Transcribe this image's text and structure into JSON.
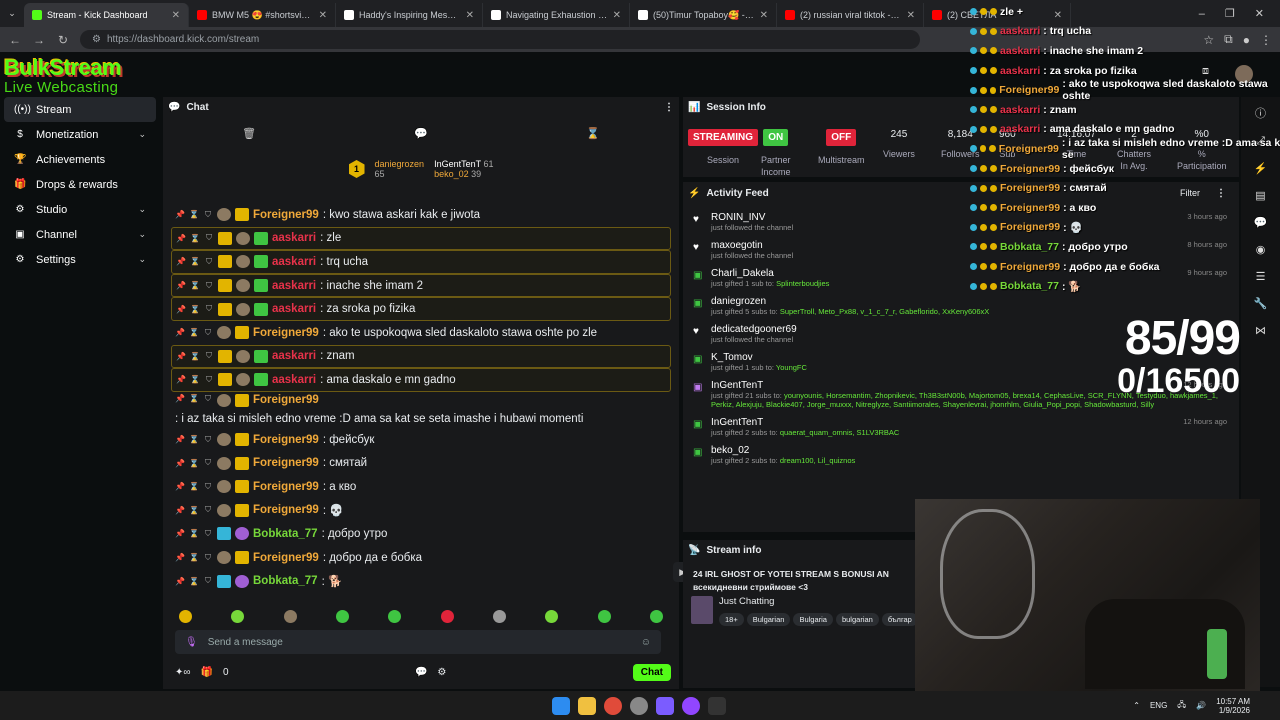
{
  "browser": {
    "tabs": [
      {
        "title": "Stream - Kick Dashboard",
        "color": "#53fc18",
        "active": true
      },
      {
        "title": "BMW M5 😍 #shortsvideo",
        "color": "#ff0000"
      },
      {
        "title": "Haddy's Inspiring Message Afte",
        "color": "#ffffff"
      },
      {
        "title": "Navigating Exhaustion in Mode",
        "color": "#ffffff"
      },
      {
        "title": "(50)Timur Topaboy🥰 - оригин",
        "color": "#ffffff"
      },
      {
        "title": "(2) russian viral tiktok - YouTub",
        "color": "#ff0000"
      },
      {
        "title": "(2) CBETЛA",
        "color": "#ff0000"
      }
    ],
    "url": "https://dashboard.kick.com/stream"
  },
  "logo": {
    "line1": "BulkStream",
    "line2": "Live Webcasting Services"
  },
  "sidebar": {
    "items": [
      {
        "label": "Stream",
        "icon": "broadcast-icon",
        "active": true
      },
      {
        "label": "Monetization",
        "icon": "dollar-icon",
        "chevron": true
      },
      {
        "label": "Achievements",
        "icon": "trophy-icon"
      },
      {
        "label": "Drops & rewards",
        "icon": "gift-icon"
      },
      {
        "label": "Studio",
        "icon": "studio-icon",
        "chevron": true
      },
      {
        "label": "Channel",
        "icon": "channel-icon",
        "chevron": true
      },
      {
        "label": "Settings",
        "icon": "gear-icon",
        "chevron": true
      }
    ]
  },
  "chat": {
    "title": "Chat",
    "leaders": [
      {
        "rank": "1",
        "name": "daniegrozen",
        "score": "65"
      },
      {
        "name": "InGentTenT",
        "score": "61"
      },
      {
        "name": "beko_02",
        "score": "39"
      }
    ],
    "messages": [
      {
        "user": "Foreigner99",
        "color": "orange",
        "text": ": kwo stawa askari kak e jiwota"
      },
      {
        "user": "aaskarri",
        "color": "red",
        "text": ": zle",
        "hl": true
      },
      {
        "user": "aaskarri",
        "color": "red",
        "text": ": trq ucha",
        "hl": true
      },
      {
        "user": "aaskarri",
        "color": "red",
        "text": ": inache she imam 2",
        "hl": true
      },
      {
        "user": "aaskarri",
        "color": "red",
        "text": ": za sroka po fizika",
        "hl": true
      },
      {
        "user": "Foreigner99",
        "color": "orange",
        "text": ": ako te uspokoqwa sled daskaloto stawa oshte po zle"
      },
      {
        "user": "aaskarri",
        "color": "red",
        "text": ": znam",
        "hl": true
      },
      {
        "user": "aaskarri",
        "color": "red",
        "text": ": ama daskalo e mn gadno",
        "hl": true
      },
      {
        "user": "Foreigner99",
        "color": "orange",
        "text": ": i az taka si misleh edno vreme :D ama sa kat se seta imashe i hubawi momenti",
        "wrap": true
      },
      {
        "user": "Foreigner99",
        "color": "orange",
        "text": ": фейсбук"
      },
      {
        "user": "Foreigner99",
        "color": "orange",
        "text": ": смятай"
      },
      {
        "user": "Foreigner99",
        "color": "orange",
        "text": ": а кво"
      },
      {
        "user": "Foreigner99",
        "color": "orange",
        "text": ": 💀"
      },
      {
        "user": "Bobkata_77",
        "color": "green",
        "text": ": добро утро"
      },
      {
        "user": "Foreigner99",
        "color": "orange",
        "text": ": добро да е бобка"
      },
      {
        "user": "Bobkata_77",
        "color": "green",
        "text": ": 🐕"
      }
    ],
    "input_placeholder": "Send a message",
    "points": "0",
    "chat_button": "Chat"
  },
  "session": {
    "title": "Session Info",
    "stats": [
      {
        "value": "STREAMING",
        "pill": "#e0243a",
        "label": "Session"
      },
      {
        "value": "ON",
        "pill": "#3fc542",
        "label": "Partner\nIncome"
      },
      {
        "value": "OFF",
        "pill": "#e0243a",
        "label": "Multistream"
      },
      {
        "value": "245",
        "label": "Viewers"
      },
      {
        "value": "8,184",
        "label": "Followers"
      },
      {
        "value": "960",
        "label": "Sub"
      },
      {
        "value": "14:16:07",
        "label": "Time"
      },
      {
        "value": "2",
        "label": "Chatters\nIn Avg."
      },
      {
        "value": "%0",
        "label": "%\nParticipation"
      }
    ]
  },
  "activity": {
    "title": "Activity Feed",
    "filter": "Filter",
    "items": [
      {
        "name": "RONIN_INV",
        "desc": "just followed the channel",
        "time": "3 hours ago",
        "icon": "heart"
      },
      {
        "name": "maxoegotin",
        "desc": "just followed the channel",
        "time": "8 hours ago",
        "icon": "heart"
      },
      {
        "name": "Charli_Dakela",
        "desc": "just gifted 1 sub to:",
        "subs": "Splinterboudjies",
        "time": "9 hours ago",
        "icon": "gift"
      },
      {
        "name": "daniegrozen",
        "desc": "just gifted 5 subs to:",
        "subs": "SuperTroll, Meto_Px88, v_1_c_7_r, Gabeflorido, XxKeny606xX",
        "time": "",
        "icon": "gift"
      },
      {
        "name": "dedicatedgooner69",
        "desc": "just followed the channel",
        "time": "",
        "icon": "heart"
      },
      {
        "name": "K_Tomov",
        "desc": "just gifted 1 sub to:",
        "subs": "YoungFC",
        "time": "",
        "icon": "gift"
      },
      {
        "name": "InGentTenT",
        "desc": "just gifted 21 subs to:",
        "subs": "younyounis, Horsemantim, Zhopnikevic, Th3B3stN00b, Majortom05, brexa14, CephasLive, SCR_FLYNN, Testyduo, hawkjames_1, Perkiz, Alexjuju, Blackie407, Jorge_muxxx, Nitreglyze, Santiimorales, Shayenlevrai, jhonrhlm, Giulia_Popi_popi, Shadowbasturd, Silly",
        "time": "12 hours ago",
        "icon": "gift-purple"
      },
      {
        "name": "InGentTenT",
        "desc": "just gifted 2 subs to:",
        "subs": "quaerat_quam_omnis, S1LV3RBAC",
        "time": "12 hours ago",
        "icon": "gift"
      },
      {
        "name": "beko_02",
        "desc": "just gifted 2 subs to:",
        "subs": "dream100, Lil_quiznos",
        "time": "",
        "icon": "gift"
      }
    ]
  },
  "streaminfo": {
    "title": "Stream info",
    "stream_title": "24 IRL GHOST OF YOTEI STREAM S BONUSI AN",
    "stream_title2": "всекидневни стриймове <3",
    "category": "Just Chatting",
    "tags": [
      "18+",
      "Bulgarian",
      "Bulgaria",
      "bulgarian",
      "българ"
    ]
  },
  "overlay": {
    "rows": [
      {
        "user": "",
        "text": "zle +"
      },
      {
        "user": "aaskarri",
        "color": "#e8324a",
        "text": ": trq ucha"
      },
      {
        "user": "aaskarri",
        "color": "#e8324a",
        "text": ": inache she imam 2"
      },
      {
        "user": "aaskarri",
        "color": "#e8324a",
        "text": ": za sroka po fizika"
      },
      {
        "user": "Foreigner99",
        "color": "#f0a93a",
        "text": ": ako te uspokoqwa sled daskaloto stawa oshte"
      },
      {
        "user": "aaskarri",
        "color": "#e8324a",
        "text": ": znam"
      },
      {
        "user": "aaskarri",
        "color": "#e8324a",
        "text": ": ama daskalo e mn gadno"
      },
      {
        "user": "Foreigner99",
        "color": "#f0a93a",
        "text": ": i az taka si misleh edno vreme :D ama sa kat se"
      },
      {
        "user": "Foreigner99",
        "color": "#f0a93a",
        "text": ": фейсбук"
      },
      {
        "user": "Foreigner99",
        "color": "#f0a93a",
        "text": ": смятай"
      },
      {
        "user": "Foreigner99",
        "color": "#f0a93a",
        "text": ": а кво"
      },
      {
        "user": "Foreigner99",
        "color": "#f0a93a",
        "text": ": 💀"
      },
      {
        "user": "Bobkata_77",
        "color": "#77d83a",
        "text": ": добро утро"
      },
      {
        "user": "Foreigner99",
        "color": "#f0a93a",
        "text": ": добро да е бобка"
      },
      {
        "user": "Bobkata_77",
        "color": "#77d83a",
        "text": ": 🐕"
      }
    ],
    "goal1": "85/99",
    "goal2": "0/16500"
  },
  "taskbar": {
    "lang": "ENG",
    "time": "10:57 AM",
    "date": "1/9/2026"
  }
}
